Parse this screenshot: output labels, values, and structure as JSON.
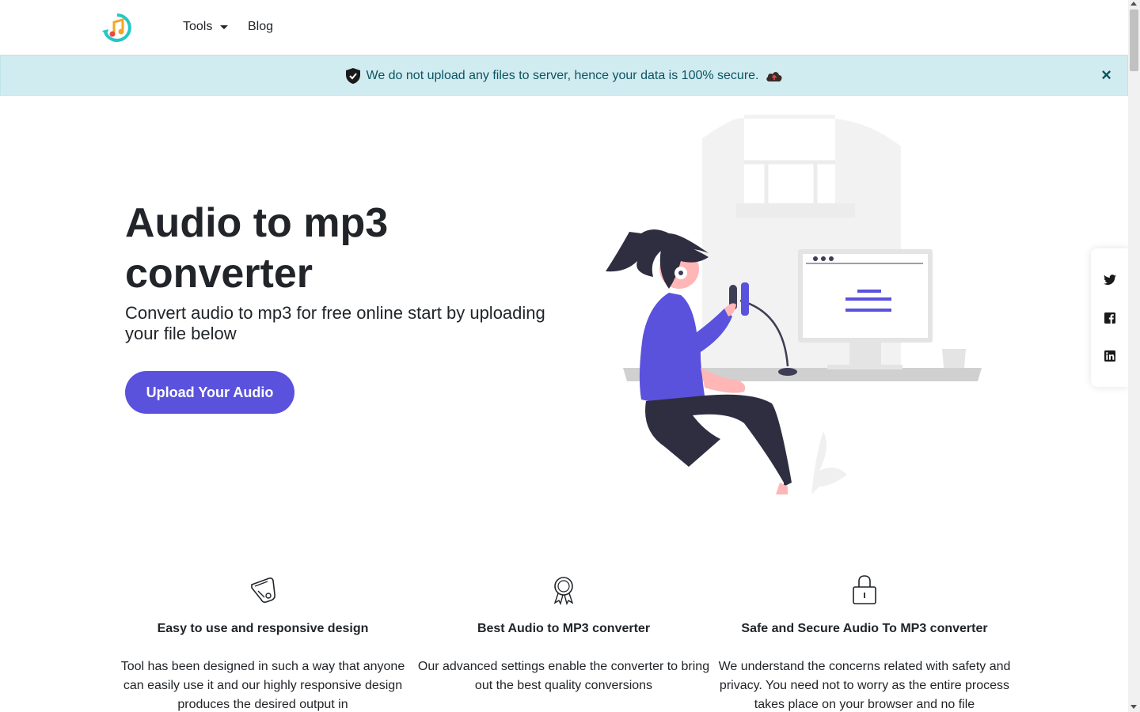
{
  "nav": {
    "logo_icon": "music-refresh-logo",
    "tools_label": "Tools",
    "blog_label": "Blog"
  },
  "alert": {
    "message": "We do not upload any files to server, hence your data is 100% secure.",
    "shield_icon": "shield-check-icon",
    "cloud_icon": "cloud-upload-icon",
    "close_label": "×"
  },
  "hero": {
    "title": "Audio to mp3 converter",
    "subtitle": "Convert audio to mp3 for free online start by uploading your file below",
    "upload_button": "Upload Your Audio",
    "accent_color": "#5a52dc"
  },
  "social": {
    "items": [
      "twitter-icon",
      "facebook-icon",
      "linkedin-icon"
    ]
  },
  "features": [
    {
      "icon": "swiss-knife-icon",
      "title": "Easy to use and responsive design",
      "text": "Tool has been designed in such a way that anyone can easily use it and our highly responsive design produces the desired output in"
    },
    {
      "icon": "award-ribbon-icon",
      "title": "Best Audio to MP3 converter",
      "text": "Our advanced settings enable the converter to bring out the best quality conversions"
    },
    {
      "icon": "lock-icon",
      "title": "Safe and Secure Audio To MP3 converter",
      "text": "We understand the concerns related with safety and privacy. You need not to worry as the entire process takes place on your browser and no file"
    }
  ]
}
